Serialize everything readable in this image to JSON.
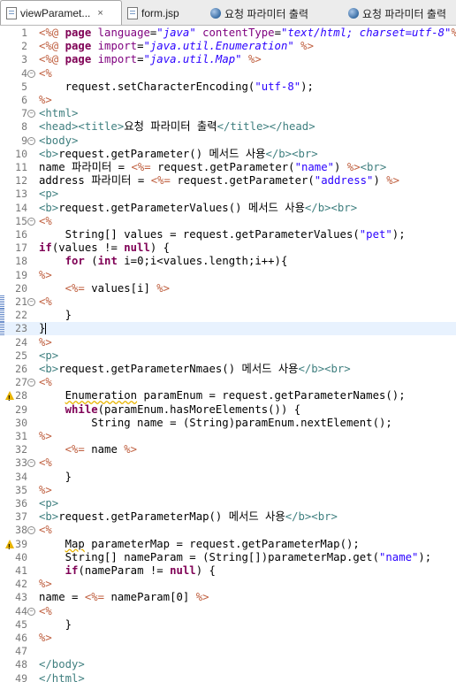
{
  "tabs": [
    {
      "label": "viewParamet...",
      "icon": "jsp-file-icon",
      "active": true,
      "closable": true
    },
    {
      "label": "form.jsp",
      "icon": "jsp-file-icon",
      "active": false
    },
    {
      "label": "요청 파라미터 출력",
      "icon": "globe-icon",
      "active": false
    },
    {
      "label": "요청 파라미터 출력",
      "icon": "globe-icon",
      "active": false
    }
  ],
  "tab_close_icon": "×",
  "lines": [
    {
      "n": "1",
      "t": [
        [
          "d",
          "<%@ "
        ],
        [
          "k",
          "page "
        ],
        [
          "a",
          "language"
        ],
        [
          "txt",
          "="
        ],
        [
          "si",
          "\"java\""
        ],
        [
          "txt",
          " "
        ],
        [
          "a",
          "contentType"
        ],
        [
          "txt",
          "="
        ],
        [
          "si",
          "\"text/html; charset=utf-8\""
        ],
        [
          "d",
          "%>"
        ]
      ]
    },
    {
      "n": "2",
      "t": [
        [
          "d",
          "<%@ "
        ],
        [
          "k",
          "page "
        ],
        [
          "a",
          "import"
        ],
        [
          "txt",
          "="
        ],
        [
          "si",
          "\"java.util.Enumeration\""
        ],
        [
          "txt",
          " "
        ],
        [
          "d",
          "%>"
        ]
      ]
    },
    {
      "n": "3",
      "t": [
        [
          "d",
          "<%@ "
        ],
        [
          "k",
          "page "
        ],
        [
          "a",
          "import"
        ],
        [
          "txt",
          "="
        ],
        [
          "si",
          "\"java.util.Map\""
        ],
        [
          "txt",
          " "
        ],
        [
          "d",
          "%>"
        ]
      ]
    },
    {
      "n": "4",
      "fold": true,
      "t": [
        [
          "d",
          "<%"
        ]
      ]
    },
    {
      "n": "5",
      "t": [
        [
          "txt",
          "    request.setCharacterEncoding("
        ],
        [
          "s",
          "\"utf-8\""
        ],
        [
          "txt",
          ");"
        ]
      ]
    },
    {
      "n": "6",
      "t": [
        [
          "d",
          "%>"
        ]
      ]
    },
    {
      "n": "7",
      "fold": true,
      "t": [
        [
          "t",
          "<html>"
        ]
      ]
    },
    {
      "n": "8",
      "t": [
        [
          "t",
          "<head><title>"
        ],
        [
          "txt",
          "요청 파라미터 출력"
        ],
        [
          "t",
          "</title></head>"
        ]
      ]
    },
    {
      "n": "9",
      "fold": true,
      "t": [
        [
          "t",
          "<body>"
        ]
      ]
    },
    {
      "n": "10",
      "t": [
        [
          "t",
          "<b>"
        ],
        [
          "txt",
          "request.getParameter() 메서드 사용"
        ],
        [
          "t",
          "</b><br>"
        ]
      ]
    },
    {
      "n": "11",
      "t": [
        [
          "txt",
          "name 파라미터 = "
        ],
        [
          "d",
          "<%="
        ],
        [
          "txt",
          " request.getParameter("
        ],
        [
          "s",
          "\"name\""
        ],
        [
          "txt",
          ") "
        ],
        [
          "d",
          "%>"
        ],
        [
          "t",
          "<br>"
        ]
      ]
    },
    {
      "n": "12",
      "t": [
        [
          "txt",
          "address 파라미터 = "
        ],
        [
          "d",
          "<%="
        ],
        [
          "txt",
          " request.getParameter("
        ],
        [
          "s",
          "\"address\""
        ],
        [
          "txt",
          ") "
        ],
        [
          "d",
          "%>"
        ]
      ]
    },
    {
      "n": "13",
      "t": [
        [
          "t",
          "<p>"
        ]
      ]
    },
    {
      "n": "14",
      "t": [
        [
          "t",
          "<b>"
        ],
        [
          "txt",
          "request.getParameterValues() 메서드 사용"
        ],
        [
          "t",
          "</b><br>"
        ]
      ]
    },
    {
      "n": "15",
      "fold": true,
      "t": [
        [
          "d",
          "<%"
        ]
      ]
    },
    {
      "n": "16",
      "t": [
        [
          "txt",
          "    String[] values = request.getParameterValues("
        ],
        [
          "s",
          "\"pet\""
        ],
        [
          "txt",
          ");"
        ]
      ]
    },
    {
      "n": "17",
      "t": [
        [
          "k",
          "if"
        ],
        [
          "txt",
          "(values != "
        ],
        [
          "k",
          "null"
        ],
        [
          "txt",
          ") {"
        ]
      ]
    },
    {
      "n": "18",
      "t": [
        [
          "txt",
          "    "
        ],
        [
          "k",
          "for"
        ],
        [
          "txt",
          " ("
        ],
        [
          "k",
          "int"
        ],
        [
          "txt",
          " i=0;i<values.length;i++){"
        ]
      ]
    },
    {
      "n": "19",
      "t": [
        [
          "d",
          "%>"
        ]
      ]
    },
    {
      "n": "20",
      "t": [
        [
          "txt",
          "    "
        ],
        [
          "d",
          "<%="
        ],
        [
          "txt",
          " values[i] "
        ],
        [
          "d",
          "%>"
        ]
      ]
    },
    {
      "n": "21",
      "fold": true,
      "mark": true,
      "t": [
        [
          "d",
          "<%"
        ]
      ]
    },
    {
      "n": "22",
      "mark": true,
      "t": [
        [
          "txt",
          "    }"
        ]
      ]
    },
    {
      "n": "23",
      "mark": true,
      "current": true,
      "cursor": true,
      "t": [
        [
          "txt",
          "}"
        ]
      ]
    },
    {
      "n": "24",
      "t": [
        [
          "d",
          "%>"
        ]
      ]
    },
    {
      "n": "25",
      "t": [
        [
          "t",
          "<p>"
        ]
      ]
    },
    {
      "n": "26",
      "t": [
        [
          "t",
          "<b>"
        ],
        [
          "txt",
          "request.getParameterNmaes() 메서드 사용"
        ],
        [
          "t",
          "</b><br>"
        ]
      ]
    },
    {
      "n": "27",
      "fold": true,
      "t": [
        [
          "d",
          "<%"
        ]
      ]
    },
    {
      "n": "28",
      "warn": true,
      "t": [
        [
          "txt",
          "    "
        ],
        [
          "w",
          "Enumeration"
        ],
        [
          "txt",
          " paramEnum = request.getParameterNames();"
        ]
      ]
    },
    {
      "n": "29",
      "t": [
        [
          "txt",
          "    "
        ],
        [
          "k",
          "while"
        ],
        [
          "txt",
          "(paramEnum.hasMoreElements()) {"
        ]
      ]
    },
    {
      "n": "30",
      "t": [
        [
          "txt",
          "        String name = (String)paramEnum.nextElement();"
        ]
      ]
    },
    {
      "n": "31",
      "t": [
        [
          "d",
          "%>"
        ]
      ]
    },
    {
      "n": "32",
      "t": [
        [
          "txt",
          "    "
        ],
        [
          "d",
          "<%="
        ],
        [
          "txt",
          " name "
        ],
        [
          "d",
          "%>"
        ]
      ]
    },
    {
      "n": "33",
      "fold": true,
      "t": [
        [
          "d",
          "<%"
        ]
      ]
    },
    {
      "n": "34",
      "t": [
        [
          "txt",
          "    }"
        ]
      ]
    },
    {
      "n": "35",
      "t": [
        [
          "d",
          "%>"
        ]
      ]
    },
    {
      "n": "36",
      "t": [
        [
          "t",
          "<p>"
        ]
      ]
    },
    {
      "n": "37",
      "t": [
        [
          "t",
          "<b>"
        ],
        [
          "txt",
          "request.getParameterMap() 메서드 사용"
        ],
        [
          "t",
          "</b><br>"
        ]
      ]
    },
    {
      "n": "38",
      "fold": true,
      "t": [
        [
          "d",
          "<%"
        ]
      ]
    },
    {
      "n": "39",
      "warn": true,
      "t": [
        [
          "txt",
          "    "
        ],
        [
          "w",
          "Map"
        ],
        [
          "txt",
          " parameterMap = request.getParameterMap();"
        ]
      ]
    },
    {
      "n": "40",
      "t": [
        [
          "txt",
          "    String[] nameParam = (String[])parameterMap.get("
        ],
        [
          "s",
          "\"name\""
        ],
        [
          "txt",
          ");"
        ]
      ]
    },
    {
      "n": "41",
      "t": [
        [
          "txt",
          "    "
        ],
        [
          "k",
          "if"
        ],
        [
          "txt",
          "(nameParam != "
        ],
        [
          "k",
          "null"
        ],
        [
          "txt",
          ") {"
        ]
      ]
    },
    {
      "n": "42",
      "t": [
        [
          "d",
          "%>"
        ]
      ]
    },
    {
      "n": "43",
      "t": [
        [
          "txt",
          "name = "
        ],
        [
          "d",
          "<%="
        ],
        [
          "txt",
          " nameParam[0] "
        ],
        [
          "d",
          "%>"
        ]
      ]
    },
    {
      "n": "44",
      "fold": true,
      "t": [
        [
          "d",
          "<%"
        ]
      ]
    },
    {
      "n": "45",
      "t": [
        [
          "txt",
          "    }"
        ]
      ]
    },
    {
      "n": "46",
      "t": [
        [
          "d",
          "%>"
        ]
      ]
    },
    {
      "n": "47",
      "t": []
    },
    {
      "n": "48",
      "t": [
        [
          "t",
          "</body>"
        ]
      ]
    },
    {
      "n": "49",
      "t": [
        [
          "t",
          "</html>"
        ]
      ]
    }
  ]
}
